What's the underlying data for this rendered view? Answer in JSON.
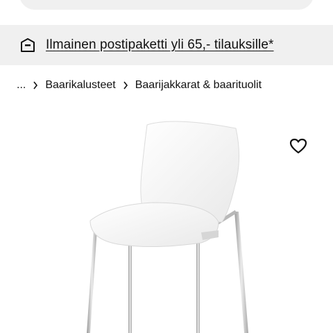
{
  "header": {
    "search_pill": ""
  },
  "promo": {
    "icon": "package-box-icon",
    "text": "Ilmainen postipaketti yli 65,- tilauksille*"
  },
  "breadcrumb": {
    "items": [
      "...",
      "Baarikalusteet",
      "Baarijakkarat & baarituolit"
    ],
    "separator_icon": "chevron-right-icon"
  },
  "product": {
    "image": "white-bar-stool-chrome-legs",
    "favorite_icon": "heart-outline-icon"
  },
  "colors": {
    "banner_bg": "#f0f0f0",
    "text": "#111111",
    "chrome": "#c8c8c8",
    "seat": "#f7f7f7"
  }
}
